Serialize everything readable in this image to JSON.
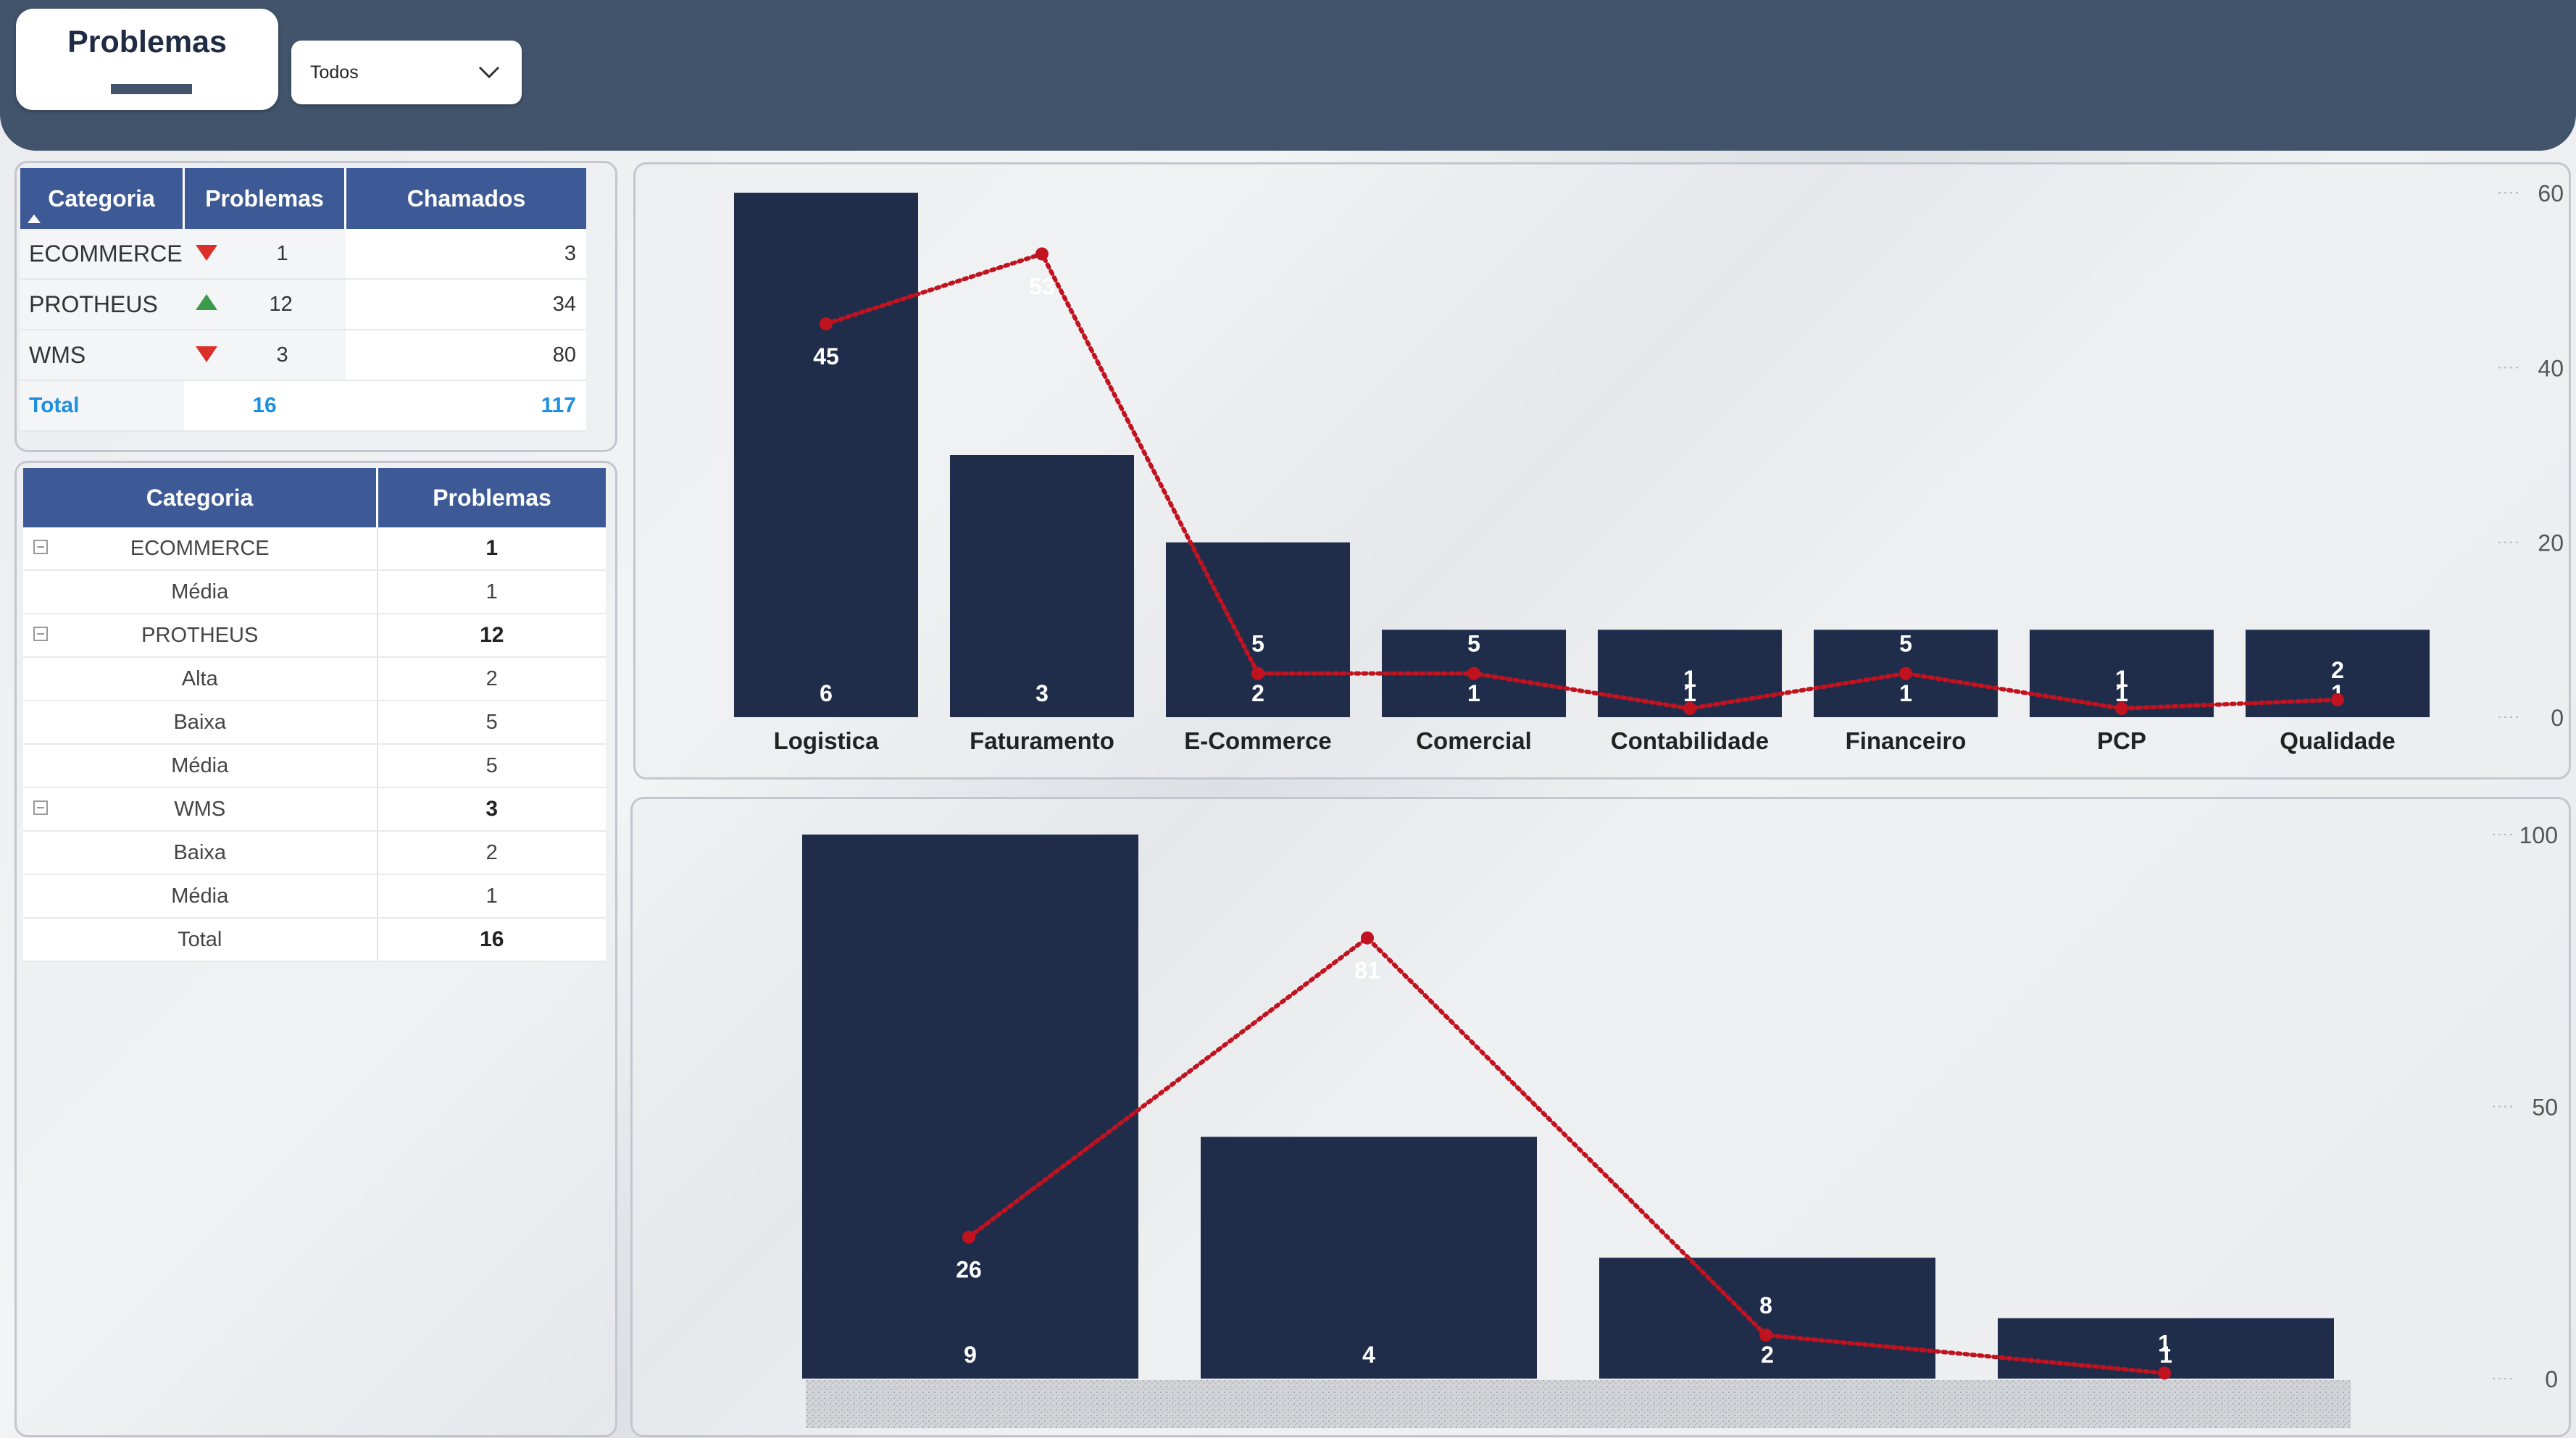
{
  "header": {
    "title": "Problemas",
    "filter": {
      "selected": "Todos"
    }
  },
  "table_summary": {
    "columns": [
      "Categoria",
      "Problemas",
      "Chamados"
    ],
    "rows": [
      {
        "categoria": "ECOMMERCE",
        "trend": "down",
        "problemas": "1",
        "chamados": "3"
      },
      {
        "categoria": "PROTHEUS",
        "trend": "up",
        "problemas": "12",
        "chamados": "34"
      },
      {
        "categoria": "WMS",
        "trend": "down",
        "problemas": "3",
        "chamados": "80"
      }
    ],
    "total": {
      "label": "Total",
      "problemas": "16",
      "chamados": "117"
    }
  },
  "table_matrix": {
    "columns": [
      "Categoria",
      "Problemas"
    ],
    "groups": [
      {
        "name": "ECOMMERCE",
        "value": "1",
        "children": [
          {
            "name": "Média",
            "value": "1"
          }
        ]
      },
      {
        "name": "PROTHEUS",
        "value": "12",
        "children": [
          {
            "name": "Alta",
            "value": "2"
          },
          {
            "name": "Baixa",
            "value": "5"
          },
          {
            "name": "Média",
            "value": "5"
          }
        ]
      },
      {
        "name": "WMS",
        "value": "3",
        "children": [
          {
            "name": "Baixa",
            "value": "2"
          },
          {
            "name": "Média",
            "value": "1"
          }
        ]
      }
    ],
    "total": {
      "label": "Total",
      "value": "16"
    }
  },
  "colors": {
    "header_bg": "#41546c",
    "bar": "#1f2d4b",
    "line": "#c1121f",
    "table_header": "#3d5a96",
    "total_text": "#1f8fe0"
  },
  "chart_data": [
    {
      "type": "bar",
      "categories": [
        "Logistica",
        "Faturamento",
        "E-Commerce",
        "Comercial",
        "Contabilidade",
        "Financeiro",
        "PCP",
        "Qualidade"
      ],
      "series": [
        {
          "values": [
            6,
            3,
            2,
            1,
            1,
            1,
            1,
            1
          ],
          "kind": "bar"
        },
        {
          "values": [
            45,
            53,
            5,
            5,
            1,
            5,
            1,
            2
          ],
          "kind": "line"
        }
      ],
      "y2_ticks": [
        0,
        20,
        40,
        60
      ],
      "y2lim": [
        0,
        60
      ]
    },
    {
      "type": "bar",
      "categories": [
        "",
        "",
        "",
        ""
      ],
      "series": [
        {
          "values": [
            9,
            4,
            2,
            1
          ],
          "kind": "bar"
        },
        {
          "values": [
            26,
            81,
            8,
            1
          ],
          "kind": "line"
        }
      ],
      "y2_ticks": [
        0,
        50,
        100
      ],
      "y2lim": [
        0,
        100
      ]
    }
  ]
}
